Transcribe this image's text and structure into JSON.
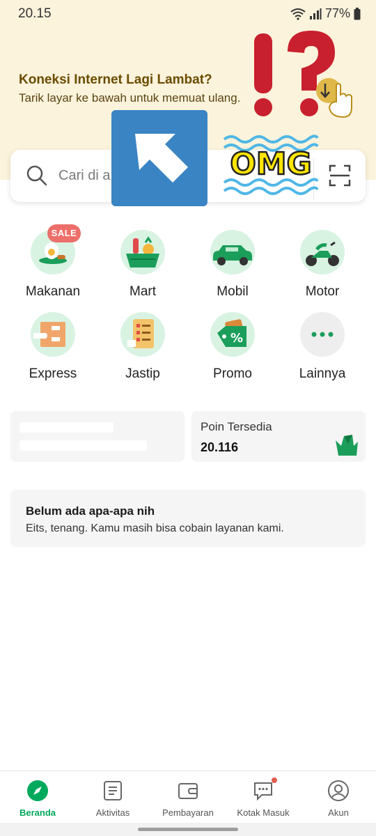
{
  "status_bar": {
    "time": "20.15",
    "battery": "77%"
  },
  "banner": {
    "title": "Koneksi Internet Lagi Lambat?",
    "subtitle": "Tarik layar ke bawah untuk memuat ulang."
  },
  "search": {
    "placeholder": "Cari di a"
  },
  "overlays": {
    "sticker_text": "OMG"
  },
  "services": [
    {
      "label": "Makanan",
      "icon": "food-icon",
      "badge": "SALE"
    },
    {
      "label": "Mart",
      "icon": "mart-icon"
    },
    {
      "label": "Mobil",
      "icon": "car-icon"
    },
    {
      "label": "Motor",
      "icon": "motorbike-icon"
    },
    {
      "label": "Express",
      "icon": "express-icon"
    },
    {
      "label": "Jastip",
      "icon": "jastip-icon"
    },
    {
      "label": "Promo",
      "icon": "promo-icon"
    },
    {
      "label": "Lainnya",
      "icon": "more-icon"
    }
  ],
  "points": {
    "label": "Poin Tersedia",
    "value": "20.116"
  },
  "empty_state": {
    "title": "Belum ada apa-apa nih",
    "subtitle": "Eits, tenang. Kamu masih bisa cobain layanan kami."
  },
  "bottom_nav": [
    {
      "label": "Beranda",
      "active": true
    },
    {
      "label": "Aktivitas"
    },
    {
      "label": "Pembayaran"
    },
    {
      "label": "Kotak Masuk"
    },
    {
      "label": "Akun"
    }
  ],
  "colors": {
    "accent": "#00a95c",
    "banner_bg": "#fbf3dc",
    "banner_title": "#6b4c00",
    "sale_badge": "#ec6f6a"
  }
}
